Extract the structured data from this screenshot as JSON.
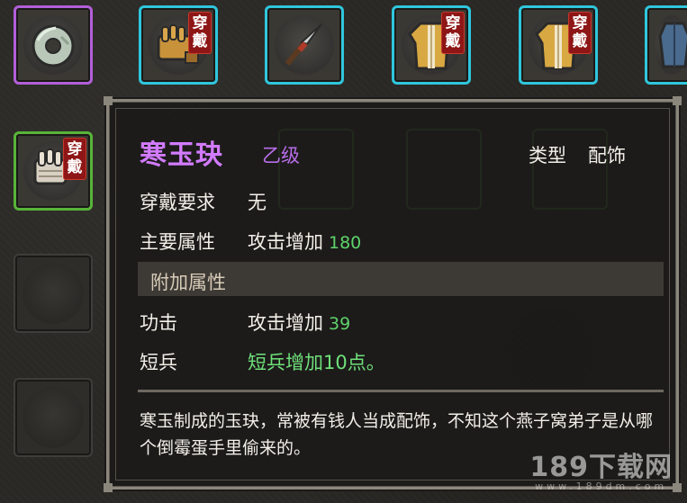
{
  "equip_badge": [
    "穿",
    "戴"
  ],
  "inventory": {
    "row1": [
      {
        "icon": "jade-ring-icon",
        "rarity": "purple",
        "equipped": false
      },
      {
        "icon": "leather-gloves-icon",
        "rarity": "cyan",
        "equipped": true
      },
      {
        "icon": "spear-head-icon",
        "rarity": "cyan",
        "equipped": false
      },
      {
        "icon": "robe-armor-icon",
        "rarity": "cyan",
        "equipped": true
      },
      {
        "icon": "robe-armor-icon",
        "rarity": "cyan",
        "equipped": true
      },
      {
        "icon": "blue-armor-icon",
        "rarity": "cyan",
        "equipped": false
      }
    ],
    "row2": [
      {
        "icon": "cloth-gloves-icon",
        "rarity": "green",
        "equipped": true
      }
    ]
  },
  "tooltip": {
    "name": "寒玉玦",
    "grade": "乙级",
    "type_label": "类型",
    "type_value": "配饰",
    "requirement_label": "穿戴要求",
    "requirement_value": "无",
    "main_attr_label": "主要属性",
    "main_attr_text": "攻击增加",
    "main_attr_num": "180",
    "extra_section_title": "附加属性",
    "extra_attrs": [
      {
        "label": "功击",
        "text": "攻击增加",
        "num": "39"
      },
      {
        "label": "短兵",
        "text": "短兵增加10点。",
        "num": ""
      }
    ],
    "description": "寒玉制成的玉玦，常被有钱人当成配饰，不知这个燕子窝弟子是从哪个倒霉蛋手里偷来的。"
  },
  "watermark": {
    "main": "189下载网",
    "sub": "www.189dm.com"
  },
  "colors": {
    "purple": "#b25fd8",
    "cyan": "#2fc6dc",
    "green": "#58b43a",
    "name_purple": "#d27bff",
    "value_green": "#5fd36a",
    "badge_red": "#8e1616"
  }
}
